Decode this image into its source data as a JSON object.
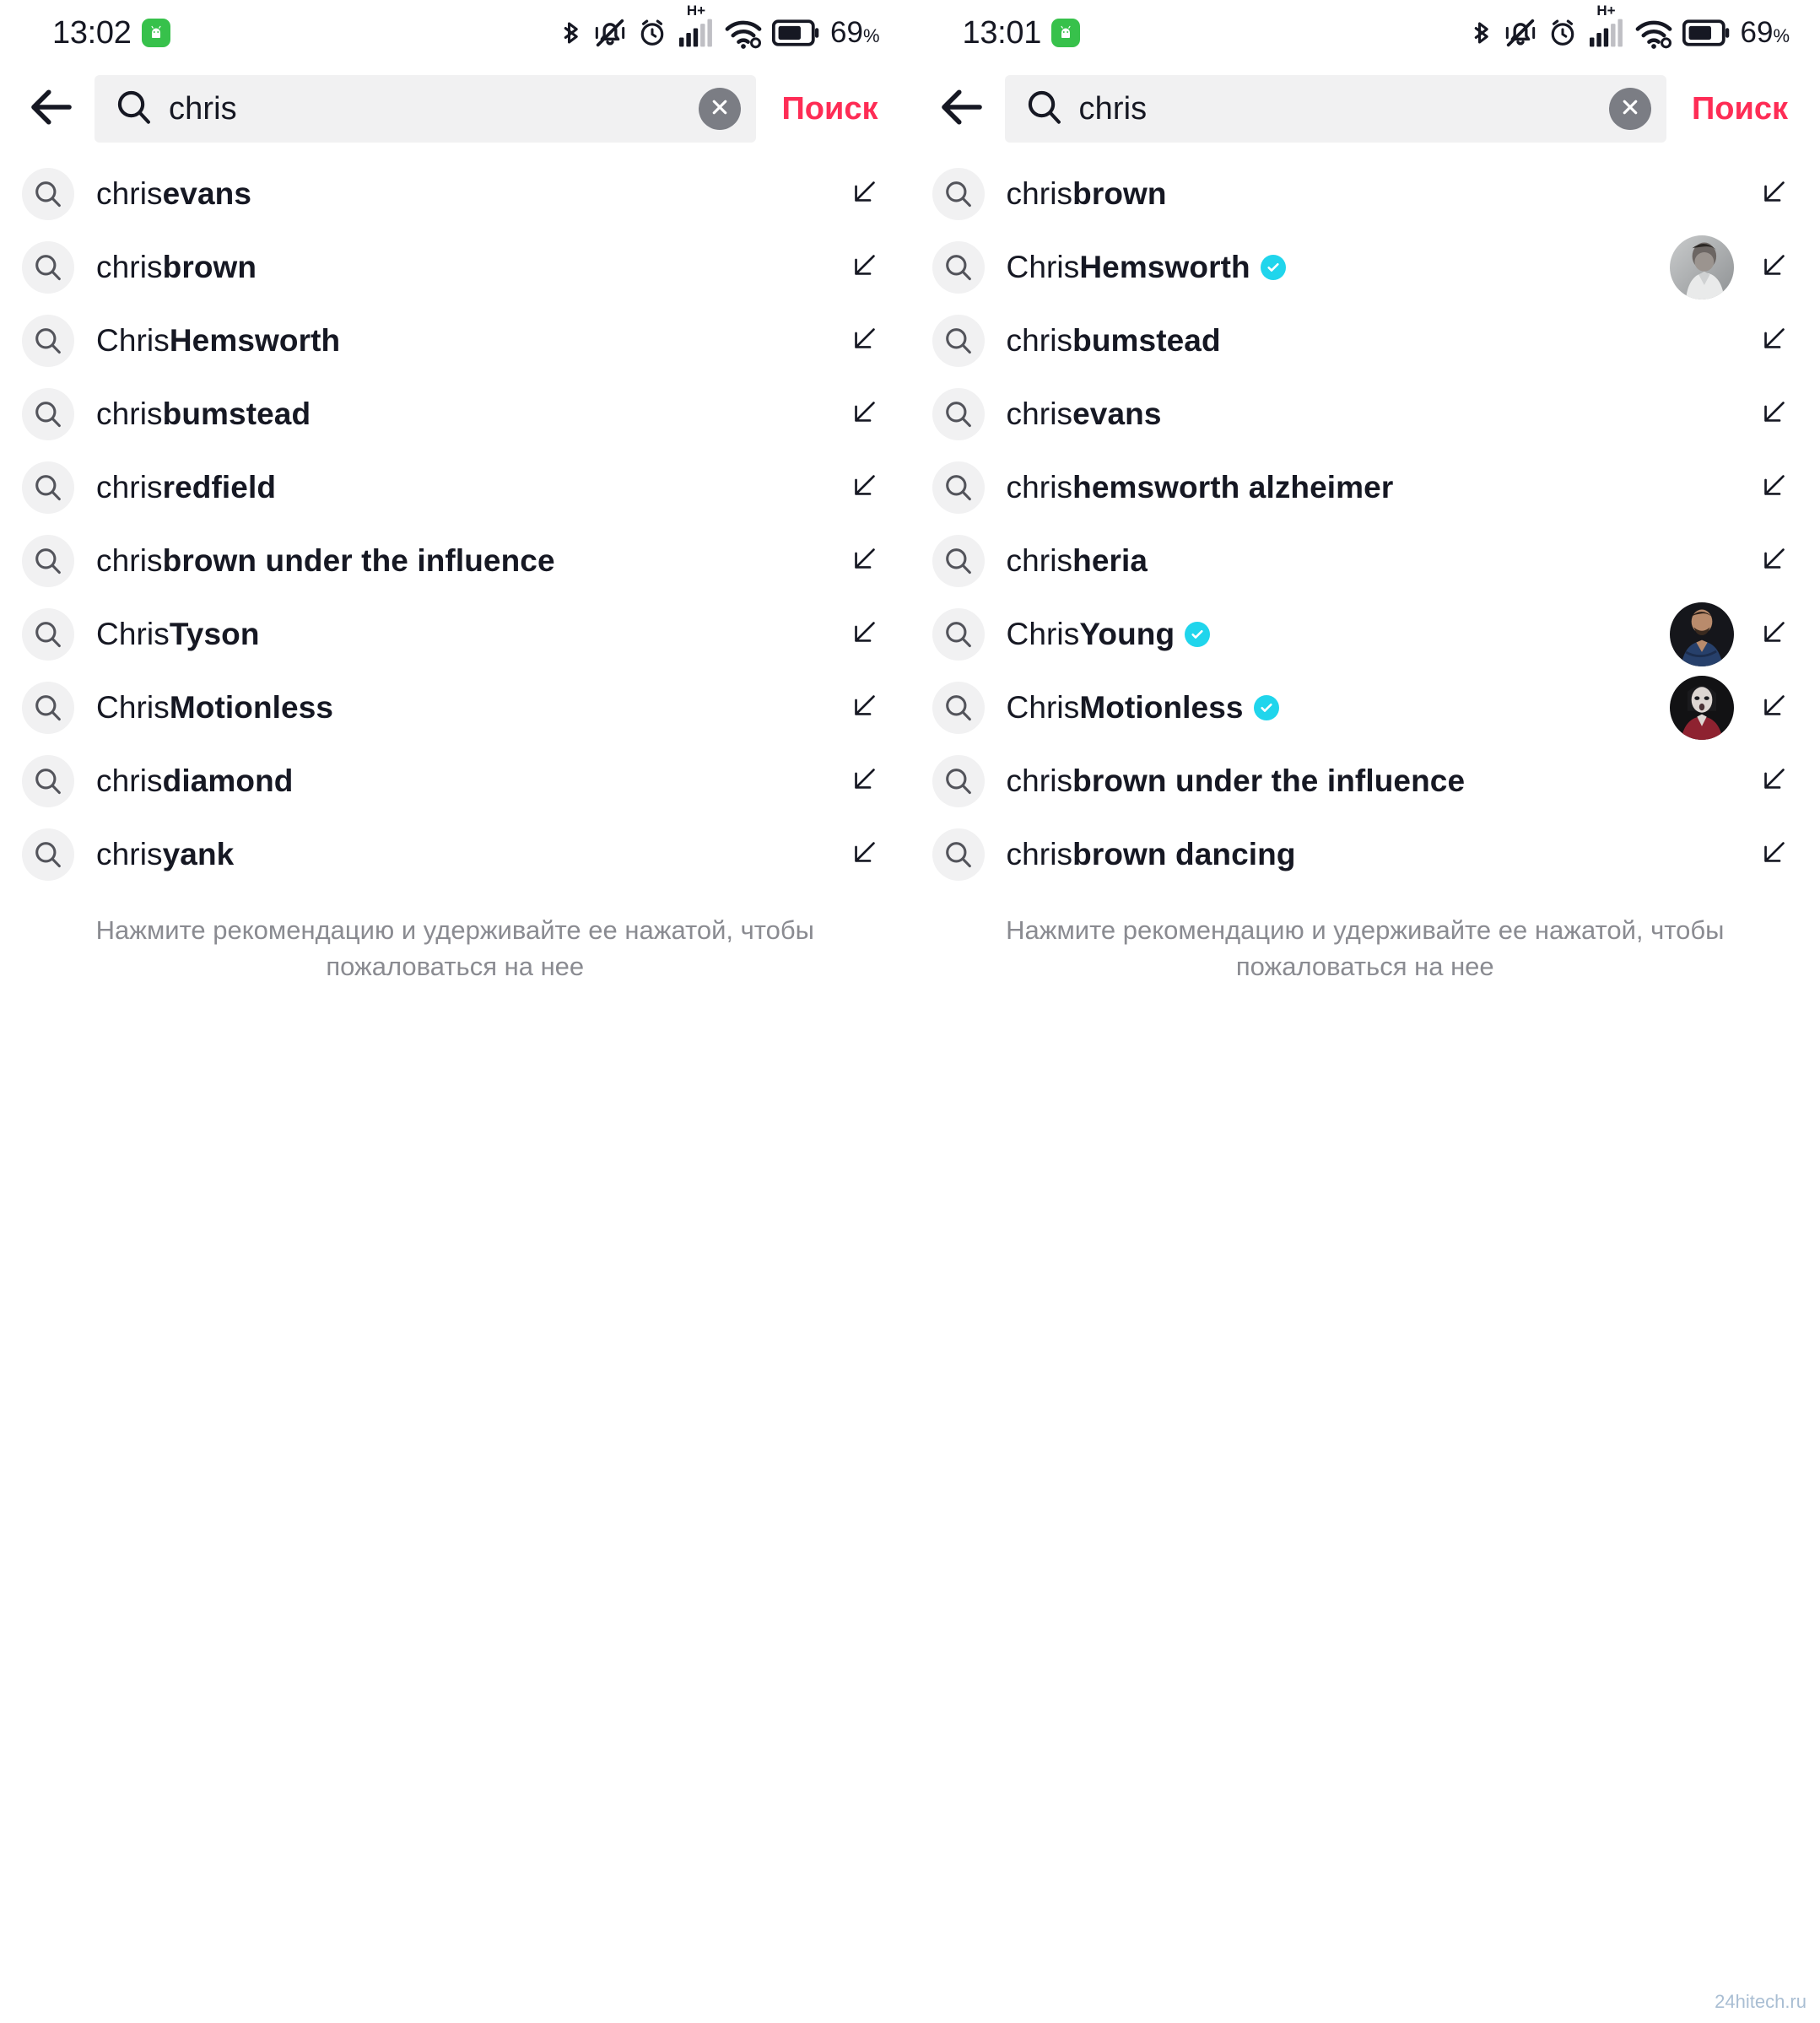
{
  "app": {
    "name": "TikTok Search",
    "accent_color": "#fe2c55",
    "verified_color": "#20d5ec",
    "field_bg": "#f1f1f2",
    "text_color": "#161823",
    "hint_color": "#8a8b91"
  },
  "watermark": "24hitech.ru",
  "screens": [
    {
      "status": {
        "time": "13:02",
        "battery_percent": "69",
        "battery_unit": "%",
        "network_label": "H+",
        "icons": [
          "android-icon",
          "bluetooth-icon",
          "mute-vibrate-icon",
          "alarm-icon",
          "signal-icon",
          "wifi-icon",
          "battery-icon"
        ]
      },
      "header": {
        "back_label": "back-arrow-icon",
        "search_value": "chris",
        "search_placeholder": "Поиск",
        "clear_label": "clear-icon",
        "submit_label": "Поиск"
      },
      "suggestions": [
        {
          "prefix": "chris ",
          "bold": "evans",
          "verified": false,
          "avatar": null
        },
        {
          "prefix": "chris ",
          "bold": "brown",
          "verified": false,
          "avatar": null
        },
        {
          "prefix": "Chris ",
          "bold": "Hemsworth",
          "verified": false,
          "avatar": null
        },
        {
          "prefix": "chris ",
          "bold": "bumstead",
          "verified": false,
          "avatar": null
        },
        {
          "prefix": "chris ",
          "bold": "redfield",
          "verified": false,
          "avatar": null
        },
        {
          "prefix": "chris ",
          "bold": "brown under the influence",
          "verified": false,
          "avatar": null
        },
        {
          "prefix": "Chris ",
          "bold": "Tyson",
          "verified": false,
          "avatar": null
        },
        {
          "prefix": "Chris ",
          "bold": "Motionless",
          "verified": false,
          "avatar": null
        },
        {
          "prefix": "chris ",
          "bold": "diamond",
          "verified": false,
          "avatar": null
        },
        {
          "prefix": "chris ",
          "bold": "yank",
          "verified": false,
          "avatar": null
        }
      ],
      "hint": "Нажмите рекомендацию и удерживайте ее нажатой, чтобы пожаловаться на нее"
    },
    {
      "status": {
        "time": "13:01",
        "battery_percent": "69",
        "battery_unit": "%",
        "network_label": "H+",
        "icons": [
          "android-icon",
          "bluetooth-icon",
          "mute-vibrate-icon",
          "alarm-icon",
          "signal-icon",
          "wifi-icon",
          "battery-icon"
        ]
      },
      "header": {
        "back_label": "back-arrow-icon",
        "search_value": "chris",
        "search_placeholder": "Поиск",
        "clear_label": "clear-icon",
        "submit_label": "Поиск"
      },
      "suggestions": [
        {
          "prefix": "chris ",
          "bold": "brown",
          "verified": false,
          "avatar": null
        },
        {
          "prefix": "Chris ",
          "bold": "Hemsworth",
          "verified": true,
          "avatar": "hemsworth-portrait"
        },
        {
          "prefix": "chris ",
          "bold": "bumstead",
          "verified": false,
          "avatar": null
        },
        {
          "prefix": "chris ",
          "bold": "evans",
          "verified": false,
          "avatar": null
        },
        {
          "prefix": "chris ",
          "bold": "hemsworth alzheimer",
          "verified": false,
          "avatar": null
        },
        {
          "prefix": "chris ",
          "bold": "heria",
          "verified": false,
          "avatar": null
        },
        {
          "prefix": "Chris ",
          "bold": "Young",
          "verified": true,
          "avatar": "young-portrait"
        },
        {
          "prefix": "Chris ",
          "bold": "Motionless",
          "verified": true,
          "avatar": "motionless-portrait"
        },
        {
          "prefix": "chris ",
          "bold": "brown under the influence",
          "verified": false,
          "avatar": null
        },
        {
          "prefix": "chris ",
          "bold": "brown dancing",
          "verified": false,
          "avatar": null
        }
      ],
      "hint": "Нажмите рекомендацию и удерживайте ее нажатой, чтобы пожаловаться на нее"
    }
  ]
}
